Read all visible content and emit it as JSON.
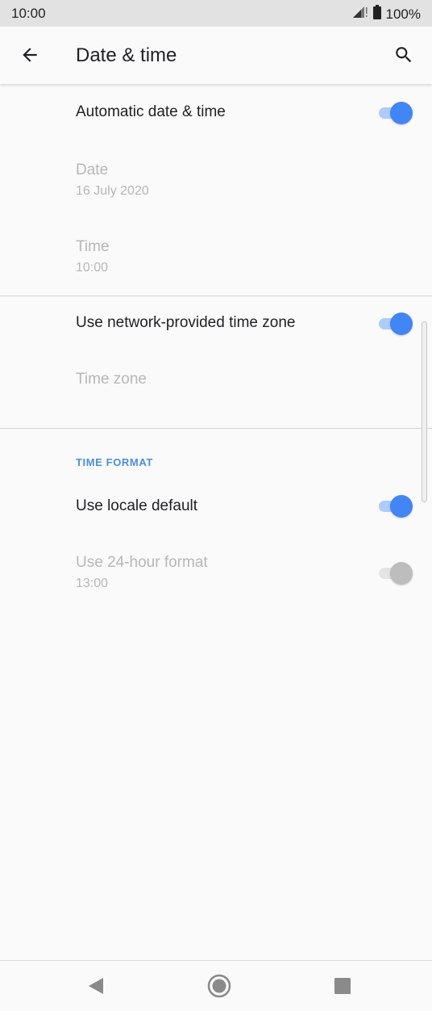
{
  "status_bar": {
    "time": "10:00",
    "battery": "100%",
    "icons": [
      "signal-icon",
      "battery-icon"
    ]
  },
  "app_bar": {
    "title": "Date & time",
    "back_icon": "arrow-back-icon",
    "search_icon": "search-icon"
  },
  "settings": {
    "automatic_date_time": {
      "title": "Automatic date & time",
      "enabled": true
    },
    "date": {
      "title": "Date",
      "value": "16 July 2020"
    },
    "time": {
      "title": "Time",
      "value": "10:00"
    },
    "network_time_zone": {
      "title": "Use network-provided time zone",
      "enabled": true
    },
    "time_zone": {
      "title": "Time zone"
    },
    "time_format_header": "TIME FORMAT",
    "locale_default": {
      "title": "Use locale default",
      "enabled": true
    },
    "use_24_hour": {
      "title": "Use 24-hour format",
      "value": "13:00",
      "enabled": false
    }
  },
  "nav_bar": {
    "icons": [
      "nav-back-icon",
      "nav-home-icon",
      "nav-recents-icon"
    ]
  },
  "colors": {
    "accent": "#4285f4",
    "accent_track": "#aecbfa",
    "switch_off_thumb": "#bdbdbd",
    "switch_off_track": "#e4e4e4",
    "section_header": "#4a8fe2"
  }
}
